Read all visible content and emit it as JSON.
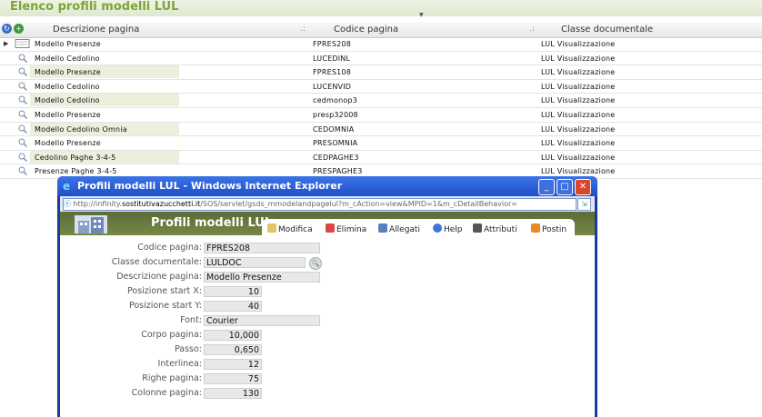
{
  "page": {
    "title": "Elenco profili modelli LUL"
  },
  "table": {
    "headers": {
      "desc": "Descrizione pagina",
      "code": "Codice pagina",
      "cls": "Classe documentale"
    },
    "rows": [
      {
        "desc": "Modello Presenze",
        "code": "FPRES208",
        "cls": "LUL Visualizzazione"
      },
      {
        "desc": "Modello Cedolino",
        "code": "LUCEDINL",
        "cls": "LUL Visualizzazione"
      },
      {
        "desc": "Modello Presenze",
        "code": "FPRES108",
        "cls": "LUL Visualizzazione"
      },
      {
        "desc": "Modello Cedolino",
        "code": "LUCENVID",
        "cls": "LUL Visualizzazione"
      },
      {
        "desc": "Modello Cedolino",
        "code": "cedmonop3",
        "cls": "LUL Visualizzazione"
      },
      {
        "desc": "Modello Presenze",
        "code": "presp32008",
        "cls": "LUL Visualizzazione"
      },
      {
        "desc": "Modello Cedolino Omnia",
        "code": "CEDOMNIA",
        "cls": "LUL Visualizzazione"
      },
      {
        "desc": "Modello Presenze",
        "code": "PRESOMNIA",
        "cls": "LUL Visualizzazione"
      },
      {
        "desc": "Cedolino Paghe 3-4-5",
        "code": "CEDPAGHE3",
        "cls": "LUL Visualizzazione"
      },
      {
        "desc": "Presenze Paghe 3-4-5",
        "code": "PRESPAGHE3",
        "cls": "LUL Visualizzazione"
      }
    ]
  },
  "popup": {
    "title": "Profili modelli LUL - Windows Internet Explorer",
    "url_prefix": "http://infinity.",
    "url_host": "sostitutivazucchetti.it",
    "url_rest": "/SOS/servlet/gsds_mmodelandpagelul?m_cAction=view&MPID=1&m_cDetailBehavior=",
    "banner_title": "Profili modelli LUL",
    "toolbar": {
      "modifica": "Modifica",
      "elimina": "Elimina",
      "allegati": "Allegati",
      "help": "Help",
      "attributi": "Attributi",
      "postin": "Postin"
    },
    "form": {
      "codice_pagina": {
        "label": "Codice pagina:",
        "value": "FPRES208"
      },
      "classe_documentale": {
        "label": "Classe documentale:",
        "value": "LULDOC"
      },
      "descrizione_pagina": {
        "label": "Descrizione pagina:",
        "value": "Modello Presenze"
      },
      "start_x": {
        "label": "Posizione start X:",
        "value": "10"
      },
      "start_y": {
        "label": "Posizione start Y:",
        "value": "40"
      },
      "font": {
        "label": "Font:",
        "value": "Courier"
      },
      "corpo_pagina": {
        "label": "Corpo pagina:",
        "value": "10,000"
      },
      "passo": {
        "label": "Passo:",
        "value": "0,650"
      },
      "interlinea": {
        "label": "Interlinea:",
        "value": "12"
      },
      "righe_pagina": {
        "label": "Righe pagina:",
        "value": "75"
      },
      "colonne_pagina": {
        "label": "Colonne pagina:",
        "value": "130"
      }
    }
  },
  "colors": {
    "accent_green": "#7ea43a",
    "ie_blue": "#1f4fc9"
  }
}
